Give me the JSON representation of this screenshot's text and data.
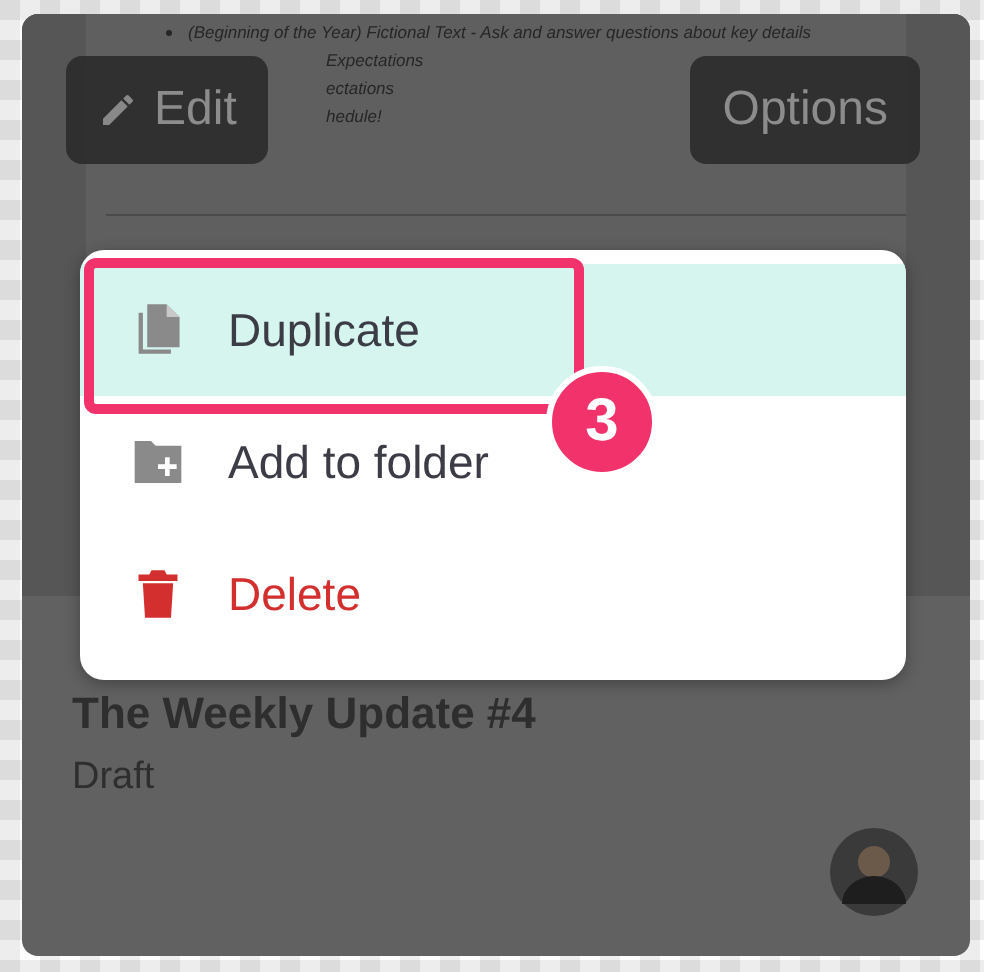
{
  "preview": {
    "lines": [
      "(Beginning of the Year) Fictional Text - Ask and answer questions about key details",
      "Expectations",
      "ectations",
      "hedule!"
    ]
  },
  "overlay_buttons": [
    {
      "label": "Edit",
      "kind": "edit"
    },
    {
      "label": "Options",
      "kind": "plain"
    }
  ],
  "card": {
    "title": "The Weekly Update #4",
    "status": "Draft"
  },
  "menu": {
    "items": [
      {
        "label": "Duplicate",
        "kind": "duplicate",
        "selected": true,
        "danger": false
      },
      {
        "label": "Add to folder",
        "kind": "folder",
        "selected": false,
        "danger": false
      },
      {
        "label": "Delete",
        "kind": "trash",
        "selected": false,
        "danger": true
      }
    ]
  },
  "callout": {
    "number": "3"
  }
}
